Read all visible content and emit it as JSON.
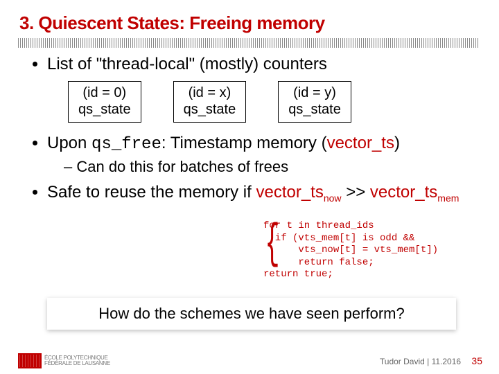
{
  "title": "3. Quiescent States: Freeing memory",
  "bullets": {
    "b1": "List of \"thread-local\" (mostly) counters",
    "b2_pre": "Upon ",
    "b2_code": "qs_free",
    "b2_post": ": Timestamp memory (",
    "b2_red": "vector_ts",
    "b2_close": ")",
    "b2_sub": "– Can do this for batches of frees",
    "b3_pre": "Safe to reuse the memory if ",
    "b3_a": "vector_ts",
    "b3_a_sub": "now",
    "b3_mid": " >> ",
    "b3_b": "vector_ts",
    "b3_b_sub": "mem"
  },
  "boxes": [
    {
      "line1": "(id = 0)",
      "line2": "qs_state"
    },
    {
      "line1": "(id = x)",
      "line2": "qs_state"
    },
    {
      "line1": "(id = y)",
      "line2": "qs_state"
    }
  ],
  "overlay_code": "for t in thread_ids\n  if (vts_mem[t] is odd &&\n      vts_now[t] = vts_mem[t])\n      return false;\nreturn true;",
  "question": "How do the schemes we have seen perform?",
  "footer": {
    "logo_text": "ÉCOLE POLYTECHNIQUE\nFÉDÉRALE DE LAUSANNE",
    "author_date": "Tudor David | 11.2016",
    "page": "35"
  }
}
